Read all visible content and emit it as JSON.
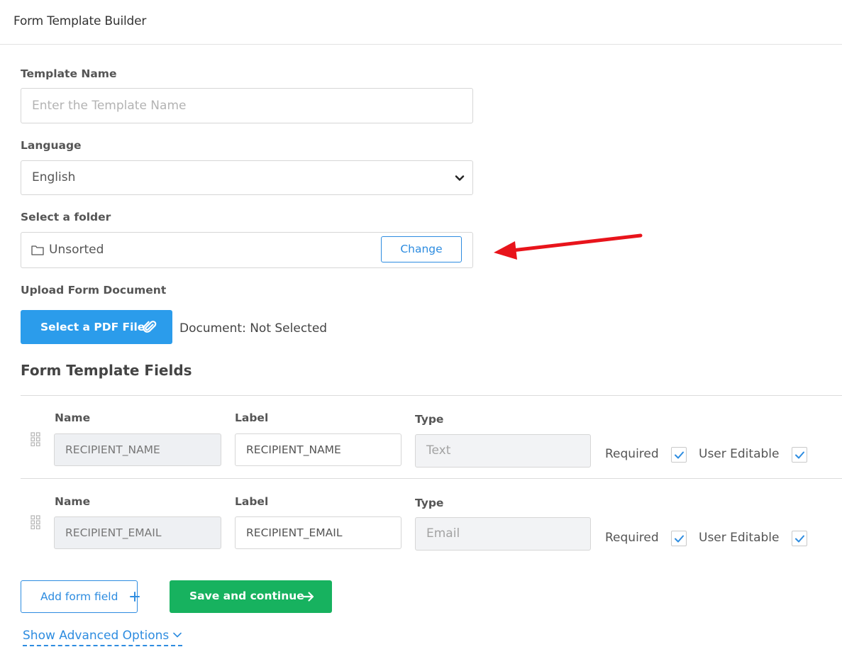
{
  "header": {
    "title": "Form Template Builder"
  },
  "template_name": {
    "label": "Template Name",
    "value": "",
    "placeholder": "Enter the Template Name"
  },
  "language": {
    "label": "Language",
    "selected": "English"
  },
  "folder": {
    "label": "Select a folder",
    "name": "Unsorted",
    "change_label": "Change"
  },
  "upload": {
    "label": "Upload Form Document",
    "button_label": "Select a PDF File",
    "status": "Document: Not Selected"
  },
  "fields_section": {
    "title": "Form Template Fields",
    "column_labels": {
      "name": "Name",
      "label": "Label",
      "type": "Type"
    },
    "required_label": "Required",
    "user_editable_label": "User Editable",
    "rows": [
      {
        "name": "RECIPIENT_NAME",
        "label": "RECIPIENT_NAME",
        "type": "Text",
        "required": true,
        "user_editable": true
      },
      {
        "name": "RECIPIENT_EMAIL",
        "label": "RECIPIENT_EMAIL",
        "type": "Email",
        "required": true,
        "user_editable": true
      }
    ]
  },
  "actions": {
    "add_field_label": "Add form field",
    "save_label": "Save and continue"
  },
  "advanced": {
    "label": "Show Advanced Options"
  },
  "colors": {
    "primary_blue": "#2b9ceb",
    "link_blue": "#2d8ce0",
    "save_green": "#17b25f",
    "annotation_arrow": "#e8141b"
  }
}
